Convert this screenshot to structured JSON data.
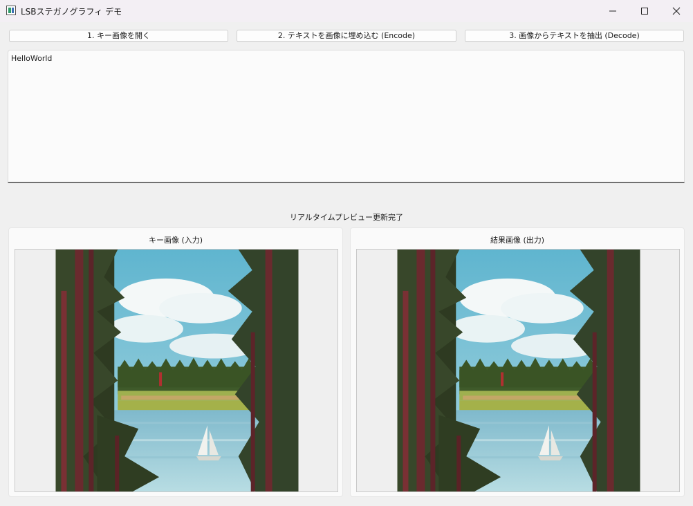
{
  "window": {
    "title": "LSBステガノグラフィ デモ",
    "icon": "app-window-icon",
    "controls": [
      "minimize-icon",
      "maximize-icon",
      "close-icon"
    ]
  },
  "toolbar": {
    "open_key_label": "1. キー画像を開く",
    "encode_label": "2. テキストを画像に埋め込む (Encode)",
    "decode_label": "3. 画像からテキストを抽出 (Decode)"
  },
  "editor": {
    "text": "HelloWorld"
  },
  "status": {
    "text": "リアルタイムプレビュー更新完了"
  },
  "panels": {
    "input_title": "キー画像 (入力)",
    "output_title": "結果画像 (出力)"
  },
  "colors": {
    "accent": "#707070",
    "background": "#f0f0f0",
    "titlebar": "#f3eff4"
  }
}
